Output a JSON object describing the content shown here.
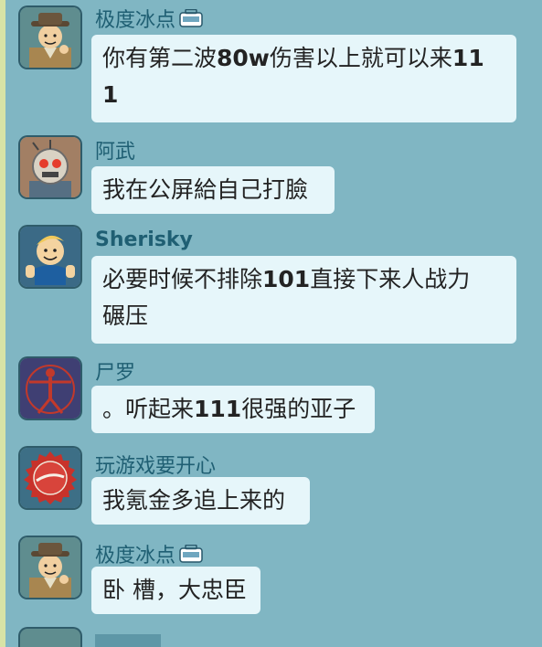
{
  "messages": [
    {
      "sender": "极度冰点",
      "icon": "vault-lunchbox-badge-icon",
      "avatar": "detective-dweller-avatar",
      "text_parts": [
        "你有第二波",
        "80w",
        "伤害以上就可以来",
        "11",
        "1"
      ]
    },
    {
      "sender": "阿武",
      "avatar": "robot-astronaut-avatar",
      "text": "我在公屏給自己打臉"
    },
    {
      "sender": "Sherisky",
      "avatar": "vault-boy-thumbs-up-avatar",
      "text_parts": [
        "必要时候不排除",
        "101",
        "直接下来人战力",
        "碾压"
      ]
    },
    {
      "sender": "尸罗",
      "avatar": "vitruvian-man-avatar",
      "text_parts": [
        "。听起来",
        "111",
        "很强的亚子"
      ]
    },
    {
      "sender": "玩游戏要开心",
      "avatar": "nuka-cola-cap-avatar",
      "text": "我氪金多追上来的"
    },
    {
      "sender": "极度冰点",
      "icon": "vault-lunchbox-badge-icon",
      "avatar": "detective-dweller-avatar",
      "text": "卧 槽，大忠臣"
    }
  ],
  "colors": {
    "background": "#80b6c3",
    "bubble": "#e6f6fa",
    "name": "#1f5f73"
  }
}
